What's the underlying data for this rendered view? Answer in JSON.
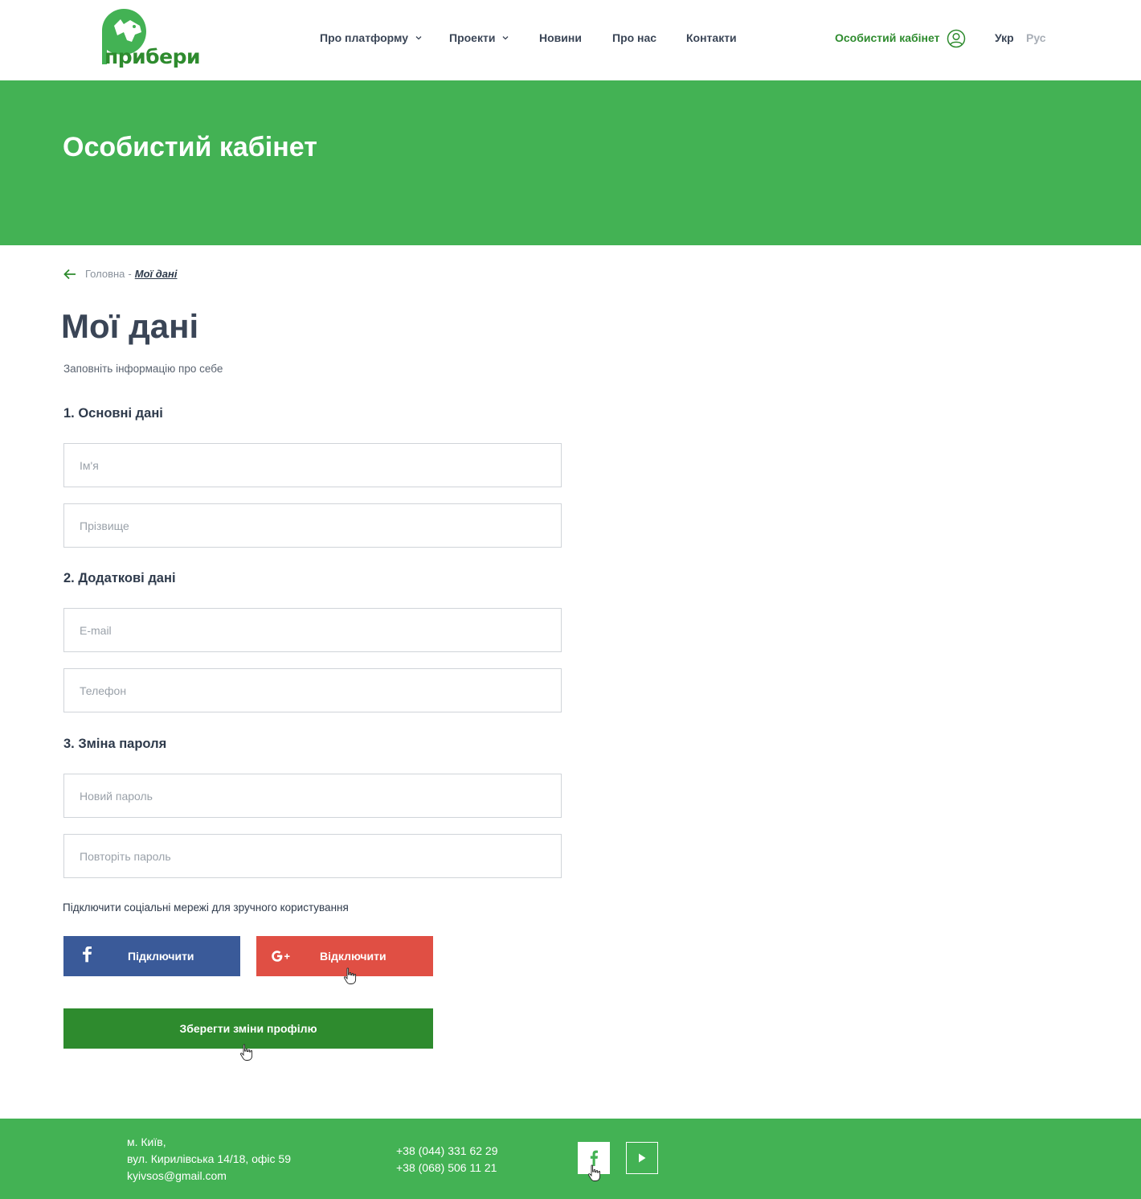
{
  "header": {
    "logo_text": "прибери",
    "nav": [
      {
        "label": "Про платформу",
        "has_dropdown": true
      },
      {
        "label": "Проекти",
        "has_dropdown": true
      },
      {
        "label": "Новини",
        "has_dropdown": false
      },
      {
        "label": "Про нас",
        "has_dropdown": false
      },
      {
        "label": "Контакти",
        "has_dropdown": false
      }
    ],
    "cabinet_label": "Особистий кабінет",
    "languages": {
      "active": "Укр",
      "inactive": "Рус"
    }
  },
  "hero": {
    "title": "Особистий кабінет"
  },
  "breadcrumb": {
    "home": "Головна",
    "separator": "-",
    "current": "Мої дані"
  },
  "page": {
    "title": "Мої дані",
    "subtitle": "Заповніть інформацію про себе"
  },
  "sections": {
    "basic": {
      "title": "1. Основні дані",
      "first_name": {
        "placeholder": "Ім'я",
        "value": ""
      },
      "last_name": {
        "placeholder": "Прізвище",
        "value": ""
      }
    },
    "extra": {
      "title": "2. Додаткові дані",
      "email": {
        "placeholder": "E-mail",
        "value": ""
      },
      "phone": {
        "placeholder": "Телефон",
        "value": ""
      }
    },
    "password": {
      "title": "3. Зміна пароля",
      "new_password": {
        "placeholder": "Новий пароль",
        "value": ""
      },
      "repeat_password": {
        "placeholder": "Повторіть пароль",
        "value": ""
      }
    }
  },
  "social": {
    "note": "Підключити соціальні мережі для зручного користування",
    "facebook_label": "Підключити",
    "google_label": "Відключити"
  },
  "save_label": "Зберегти зміни профілю",
  "footer": {
    "address_line1": "м. Київ,",
    "address_line2": "вул. Кирилівська 14/18, офіс 59",
    "email": "kyivsos@gmail.com",
    "phone1": "+38 (044) 331 62 29",
    "phone2": "+38 (068) 506 11 21"
  },
  "colors": {
    "brand_green": "#43b254",
    "dark_green": "#2e8b2e",
    "facebook_blue": "#3a5a99",
    "google_red": "#e04f44"
  },
  "icons": [
    "logo-dog-icon",
    "chevron-down-icon",
    "user-icon",
    "arrow-left-icon",
    "facebook-icon",
    "google-plus-icon",
    "youtube-play-icon",
    "hand-cursor-icon"
  ]
}
